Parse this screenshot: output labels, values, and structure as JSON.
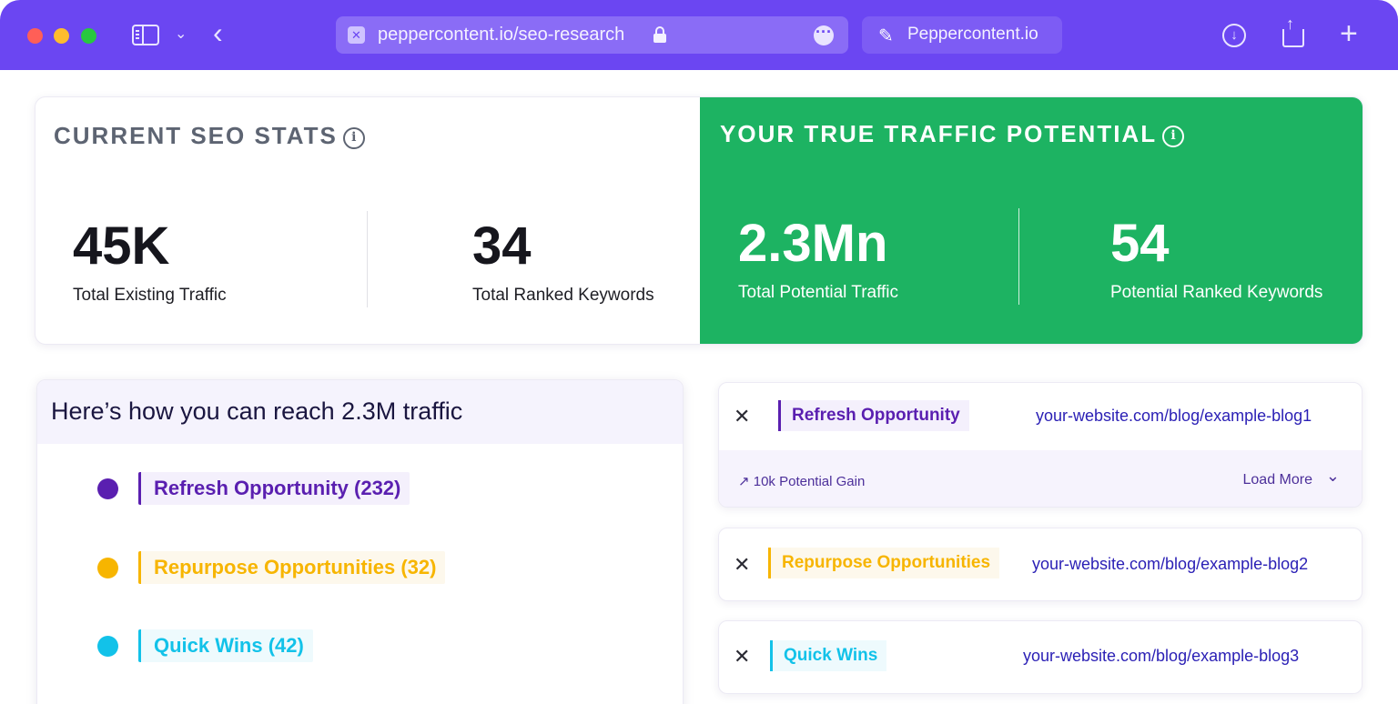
{
  "browser": {
    "url": "peppercontent.io/seo-research",
    "tab_label": "Peppercontent.io",
    "back_glyph": "‹",
    "plus_glyph": "+",
    "accent_color": "#6b46f2"
  },
  "current_stats": {
    "title": "CURRENT SEO STATS",
    "traffic_value": "45K",
    "traffic_label": "Total Existing Traffic",
    "keywords_value": "34",
    "keywords_label": "Total Ranked Keywords"
  },
  "potential_stats": {
    "title": "YOUR TRUE TRAFFIC POTENTIAL",
    "traffic_value": "2.3Mn",
    "traffic_label": "Total Potential Traffic",
    "keywords_value": "54",
    "keywords_label": "Potential Ranked Keywords",
    "color": "#1db362"
  },
  "reach": {
    "title": "Here’s how you can reach 2.3M traffic",
    "items": [
      {
        "label": "Refresh Opportunity (232)",
        "color": "#5a1fb0"
      },
      {
        "label": "Repurpose Opportunities (32)",
        "color": "#f7b500"
      },
      {
        "label": "Quick Wins (42)",
        "color": "#12c2e9"
      }
    ]
  },
  "cards": [
    {
      "tag": "Refresh Opportunity",
      "url": "your-website.com/blog/example-blog1",
      "gain": "10k Potential Gain",
      "load_more": "Load More"
    },
    {
      "tag": "Repurpose Opportunities",
      "url": "your-website.com/blog/example-blog2"
    },
    {
      "tag": "Quick Wins",
      "url": "your-website.com/blog/example-blog3"
    }
  ]
}
